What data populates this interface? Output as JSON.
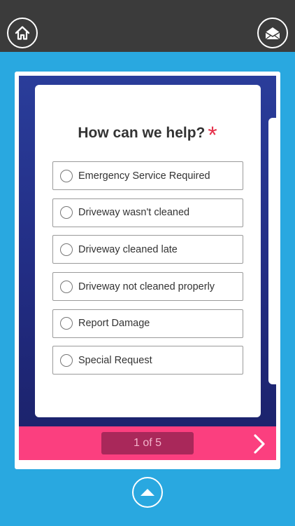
{
  "header": {
    "home_icon": "home-icon",
    "mail_icon": "envelope-icon"
  },
  "form": {
    "question": "How can we help?",
    "required_mark": "*",
    "options": [
      {
        "label": "Emergency Service Required"
      },
      {
        "label": "Driveway wasn't cleaned"
      },
      {
        "label": "Driveway cleaned late"
      },
      {
        "label": "Driveway not cleaned properly"
      },
      {
        "label": "Report Damage"
      },
      {
        "label": "Special Request"
      }
    ]
  },
  "footer": {
    "pager": "1 of 5",
    "next_icon": "chevron-right-icon"
  },
  "bottom": {
    "up_icon": "triangle-up-icon"
  },
  "colors": {
    "background": "#29a8e0",
    "topbar": "#3b3b3b",
    "panel": "#222d84",
    "footer": "#fb3f7f",
    "pager": "#a9285a",
    "required": "#e6314b"
  }
}
